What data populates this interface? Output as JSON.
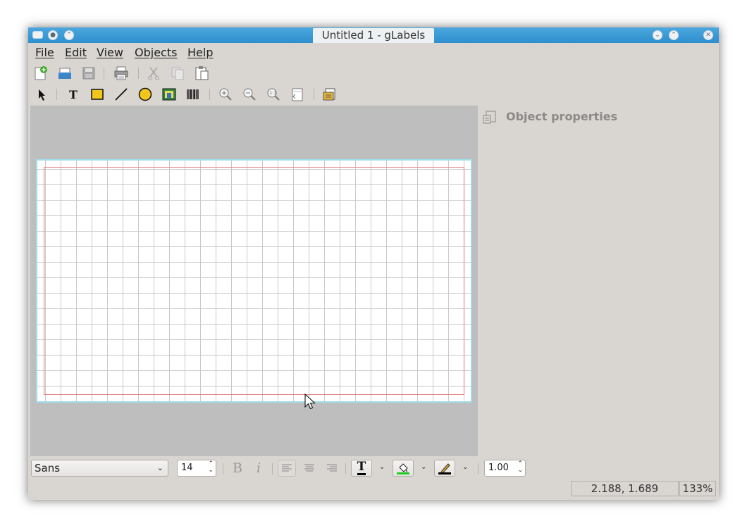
{
  "window": {
    "title": "Untitled 1 - gLabels"
  },
  "menu": {
    "items": [
      "File",
      "Edit",
      "View",
      "Objects",
      "Help"
    ]
  },
  "toolbar_main": {
    "icons": [
      "new-icon",
      "open-icon",
      "save-icon",
      "print-icon",
      "cut-icon",
      "copy-icon",
      "paste-icon"
    ]
  },
  "toolbar_objects": {
    "icons": [
      "arrow-select-icon",
      "text-tool-icon",
      "box-tool-icon",
      "line-tool-icon",
      "ellipse-tool-icon",
      "image-tool-icon",
      "barcode-tool-icon",
      "zoom-in-icon",
      "zoom-out-icon",
      "zoom-one-icon",
      "zoom-fit-icon",
      "merge-properties-icon"
    ]
  },
  "properties_panel": {
    "title": "Object properties"
  },
  "format_toolbar": {
    "font_family": "Sans",
    "font_size": "14",
    "bold_glyph": "B",
    "italic_glyph": "i",
    "text_color_glyph": "T",
    "line_width": "1.00",
    "colors": {
      "text_underline": "#000000",
      "fill_underline": "#22cc22",
      "line_underline": "#000000"
    }
  },
  "status": {
    "cursor_position": "2.188, 1.689",
    "zoom": "133%"
  }
}
